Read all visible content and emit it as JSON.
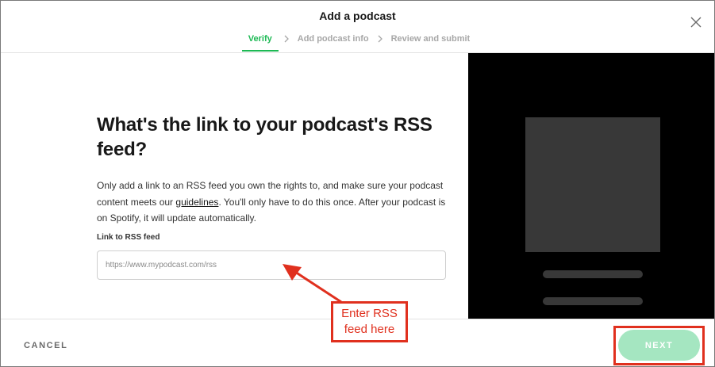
{
  "dialog": {
    "title": "Add a podcast",
    "close_icon": "close-icon"
  },
  "steps": [
    {
      "label": "Verify",
      "active": true
    },
    {
      "label": "Add podcast info",
      "active": false
    },
    {
      "label": "Review and submit",
      "active": false
    }
  ],
  "main": {
    "heading": "What's the link to your podcast's RSS feed?",
    "desc_before": "Only add a link to an RSS feed you own the rights to, and make sure your podcast content meets our ",
    "desc_link": "guidelines",
    "desc_after": ". You'll only have to do this once. After your podcast is on Spotify, it will update automatically.",
    "field_label": "Link to RSS feed",
    "field_placeholder": "https://www.mypodcast.com/rss",
    "field_value": ""
  },
  "footer": {
    "cancel_label": "CANCEL",
    "next_label": "NEXT"
  },
  "annotation": {
    "callout_line1": "Enter RSS",
    "callout_line2": "feed here"
  },
  "colors": {
    "accent": "#1db954",
    "next_disabled": "#a5e6c1",
    "annotation_red": "#e0301e",
    "preview_bg": "#000000",
    "placeholder_block": "#383838"
  }
}
